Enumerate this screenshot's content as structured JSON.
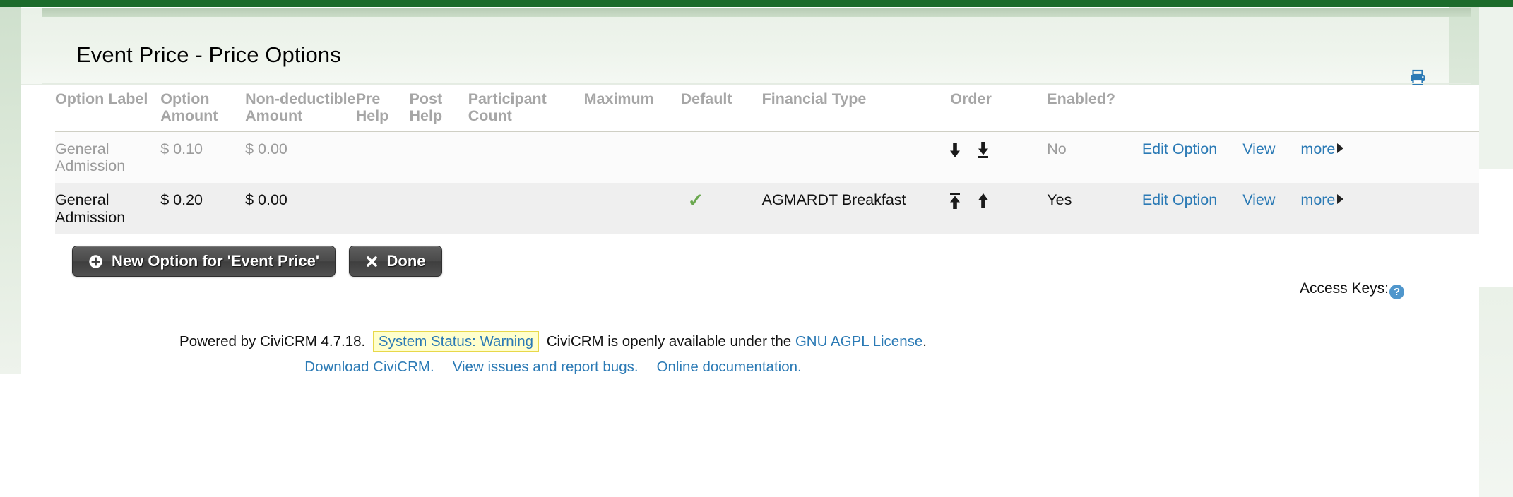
{
  "page": {
    "title": "Event Price - Price Options",
    "print_icon": "printer-icon"
  },
  "table": {
    "headers": [
      "Option Label",
      "Option Amount",
      "Non-deductible Amount",
      "Pre Help",
      "Post Help",
      "Participant Count",
      "Maximum",
      "Default",
      "Financial Type",
      "Order",
      "Enabled?"
    ],
    "rows": [
      {
        "option_label": "General Admission",
        "option_amount": "$ 0.10",
        "non_deductible_amount": "$ 0.00",
        "pre_help": "",
        "post_help": "",
        "participant_count": "",
        "maximum": "",
        "default": "",
        "financial_type": "",
        "order_icons": [
          "move-down-icon",
          "move-to-bottom-icon"
        ],
        "enabled": "No",
        "actions": {
          "edit": "Edit Option",
          "view": "View",
          "more": "more"
        }
      },
      {
        "option_label": "General Admission",
        "option_amount": "$ 0.20",
        "non_deductible_amount": "$ 0.00",
        "pre_help": "",
        "post_help": "",
        "participant_count": "",
        "maximum": "",
        "default": "check-mark-icon",
        "financial_type": "AGMARDT Breakfast",
        "order_icons": [
          "move-to-top-icon",
          "move-up-icon"
        ],
        "enabled": "Yes",
        "actions": {
          "edit": "Edit Option",
          "view": "View",
          "more": "more"
        }
      }
    ]
  },
  "buttons": {
    "new_option": "New Option for 'Event Price'",
    "new_option_icon": "plus-circle-icon",
    "done": "Done",
    "done_icon": "x-icon"
  },
  "access_keys": {
    "label": "Access Keys:",
    "help_icon": "question-mark-icon",
    "help_glyph": "?"
  },
  "footer": {
    "powered_by": "Powered by CiviCRM 4.7.18.",
    "system_status": "System Status: Warning",
    "openly_available": "CiviCRM is openly available under the",
    "license_link": "GNU AGPL License",
    "license_period": ".",
    "download": "Download CiviCRM.",
    "issues": "View issues and report bugs.",
    "docs": "Online documentation."
  },
  "colors": {
    "accent_green": "#1c6b2b",
    "link_blue": "#2b7ab5",
    "warning_bg": "#ffffcc",
    "warning_border": "#e8d84a",
    "check_green": "#6aa84f",
    "header_text": "#a6a6a6",
    "disabled_text": "#9b9b9b"
  }
}
